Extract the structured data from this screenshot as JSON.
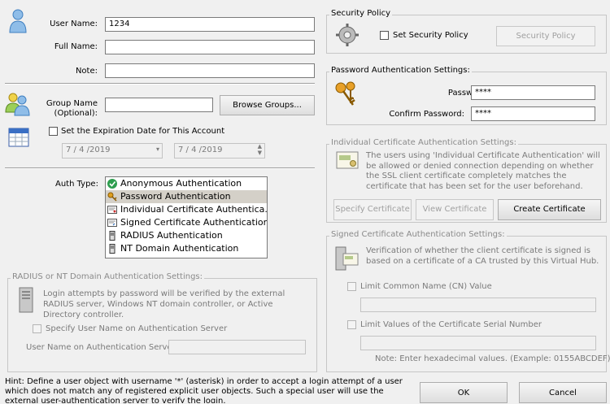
{
  "user": {
    "username_label": "User Name:",
    "username_value": "1234",
    "fullname_label": "Full Name:",
    "fullname_value": "",
    "note_label": "Note:",
    "note_value": ""
  },
  "group": {
    "label_line1": "Group Name",
    "label_line2": "(Optional):",
    "value": "",
    "browse_button": "Browse Groups..."
  },
  "expiration": {
    "checkbox_label": "Set the Expiration Date for This Account",
    "date_value": "7 / 4 /2019",
    "time_value": "7 / 4 /2019"
  },
  "auth": {
    "label": "Auth Type:",
    "types": [
      "Anonymous Authentication",
      "Password Authentication",
      "Individual Certificate Authentica...",
      "Signed Certificate Authentication",
      "RADIUS Authentication",
      "NT Domain Authentication"
    ],
    "selected_index": 1
  },
  "radius": {
    "title": "RADIUS or NT Domain Authentication Settings:",
    "description": "Login attempts by password will be verified by the external RADIUS server, Windows NT domain controller, or Active Directory controller.",
    "specify_label": "Specify User Name on Authentication Server",
    "server_username_label": "User Name on Authentication Server:",
    "server_username_value": ""
  },
  "security_policy": {
    "title": "Security Policy",
    "checkbox_label": "Set Security Policy",
    "button": "Security Policy"
  },
  "password_settings": {
    "title": "Password Authentication Settings:",
    "password_label": "Password:",
    "password_value": "****",
    "confirm_label": "Confirm Password:",
    "confirm_value": "****"
  },
  "individual_cert": {
    "title": "Individual Certificate Authentication Settings:",
    "description": "The users using 'Individual Certificate Authentication' will be allowed or denied connection depending on whether the SSL client certificate completely matches the certificate that has been set for the user beforehand.",
    "specify_button": "Specify Certificate",
    "view_button": "View Certificate",
    "create_button": "Create Certificate"
  },
  "signed_cert": {
    "title": "Signed Certificate Authentication Settings:",
    "description": "Verification of whether the client certificate is signed is based on a certificate of a CA trusted by this Virtual Hub.",
    "cn_label": "Limit Common Name (CN) Value",
    "cn_value": "",
    "serial_label": "Limit Values of the Certificate Serial Number",
    "serial_value": "",
    "note": "Note: Enter hexadecimal values. (Example: 0155ABCDEF)"
  },
  "hint": "Hint: Define a user object with username '*' (asterisk) in order to accept a login attempt of a user which does not match any of registered explicit user objects. Such a special user will use the external user-authentication server to verify the login.",
  "footer": {
    "ok_button": "OK",
    "cancel_button": "Cancel"
  }
}
